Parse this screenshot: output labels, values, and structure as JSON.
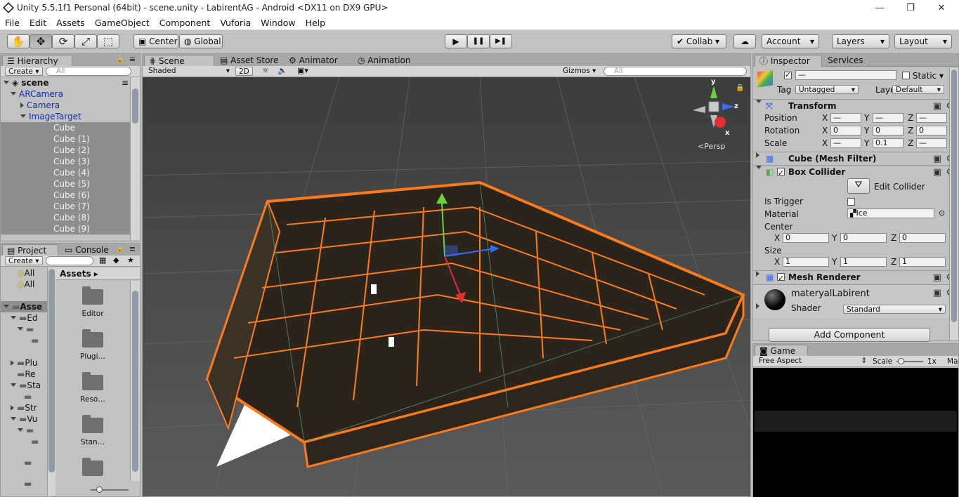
{
  "window": {
    "title": "Unity 5.5.1f1 Personal (64bit) - scene.unity - LabirentAG - Android <DX11 on DX9 GPU>",
    "min_glyph": "—",
    "max_glyph": "❐",
    "close_glyph": "✕"
  },
  "menu": [
    "File",
    "Edit",
    "Assets",
    "GameObject",
    "Component",
    "Vuforia",
    "Window",
    "Help"
  ],
  "toolbar": {
    "tools": [
      "hand-icon",
      "move-icon",
      "rotate-icon",
      "scale-icon",
      "rect-icon"
    ],
    "tool_glyphs": [
      "✋",
      "✥",
      "⟳",
      "⤢",
      "⬚"
    ],
    "center_label": "Center",
    "global_label": "Global",
    "play_glyph": "▶",
    "pause_glyph": "❚❚",
    "step_glyph": "▶❚",
    "collab_label": "Collab ▾",
    "cloud_glyph": "☁",
    "account_label": "Account",
    "layers_label": "Layers",
    "layout_label": "Layout"
  },
  "hierarchy": {
    "tab": "Hierarchy",
    "create": "Create",
    "search_placeholder": "All",
    "scene": "scene",
    "items": [
      {
        "label": "ARCamera",
        "indent": 1,
        "arrow": "down",
        "color": "blue"
      },
      {
        "label": "Camera",
        "indent": 2,
        "arrow": "right",
        "color": "blue"
      },
      {
        "label": "ImageTarget",
        "indent": 2,
        "arrow": "down",
        "color": "blue"
      },
      {
        "label": "Cube",
        "indent": 3,
        "arrow": "",
        "color": "grey"
      },
      {
        "label": "Cube (1)",
        "indent": 3,
        "arrow": "",
        "color": "grey"
      },
      {
        "label": "Cube (2)",
        "indent": 3,
        "arrow": "",
        "color": "grey"
      },
      {
        "label": "Cube (3)",
        "indent": 3,
        "arrow": "",
        "color": "grey"
      },
      {
        "label": "Cube (4)",
        "indent": 3,
        "arrow": "",
        "color": "grey"
      },
      {
        "label": "Cube (5)",
        "indent": 3,
        "arrow": "",
        "color": "grey"
      },
      {
        "label": "Cube (6)",
        "indent": 3,
        "arrow": "",
        "color": "grey"
      },
      {
        "label": "Cube (7)",
        "indent": 3,
        "arrow": "",
        "color": "grey"
      },
      {
        "label": "Cube (8)",
        "indent": 3,
        "arrow": "",
        "color": "grey"
      },
      {
        "label": "Cube (9)",
        "indent": 3,
        "arrow": "",
        "color": "grey"
      }
    ]
  },
  "project": {
    "tab_project": "Project",
    "tab_console": "Console",
    "create": "Create",
    "tree": [
      "All",
      "All",
      "Asse",
      "Ed",
      "",
      "",
      "Plu",
      "Re",
      "Sta",
      "",
      "Str",
      "Vu",
      "",
      "",
      "",
      ""
    ],
    "assets_header": "Assets ▸",
    "folders": [
      "Editor",
      "Plugi…",
      "Reso…",
      "Stan…",
      ""
    ]
  },
  "scene": {
    "tabs": [
      "Scene",
      "Asset Store",
      "Animator",
      "Animation"
    ],
    "shading": "Shaded",
    "mode_2d": "2D",
    "gizmos": "Gizmos",
    "search_placeholder": "All",
    "persp_label": "Persp",
    "axis_y": "y",
    "axis_z": "z",
    "axis_x": "x"
  },
  "inspector": {
    "tab": "Inspector",
    "tab_services": "Services",
    "name_value": "—",
    "static_label": "Static",
    "tag_label": "Tag",
    "tag_value": "Untagged",
    "layer_label": "Layer",
    "layer_value": "Default",
    "transform": {
      "title": "Transform",
      "rows": [
        {
          "label": "Position",
          "x": "—",
          "y": "—",
          "z": "—"
        },
        {
          "label": "Rotation",
          "x": "0",
          "y": "0",
          "z": "0"
        },
        {
          "label": "Scale",
          "x": "—",
          "y": "0.1",
          "z": "—"
        }
      ]
    },
    "mesh_filter": "Cube (Mesh Filter)",
    "box_collider": {
      "title": "Box Collider",
      "edit_label": "Edit Collider",
      "trigger_label": "Is Trigger",
      "material_label": "Material",
      "material_value": "Ice",
      "center_label": "Center",
      "center": {
        "x": "0",
        "y": "0",
        "z": "0"
      },
      "size_label": "Size",
      "size": {
        "x": "1",
        "y": "1",
        "z": "1"
      }
    },
    "mesh_renderer": "Mesh Renderer",
    "material": {
      "name": "materyalLabirent",
      "shader_label": "Shader",
      "shader_value": "Standard"
    },
    "add_component": "Add Component"
  },
  "game": {
    "tab": "Game",
    "aspect": "Free Aspect",
    "scale_label": "Scale",
    "scale_value": "1x",
    "extra": "Ma"
  },
  "axis_labels": {
    "x": "X",
    "y": "Y",
    "z": "Z"
  },
  "colors": {
    "maze_outline": "#ff7a1a",
    "scene_bg": "#4a4a4a",
    "selection_blue": "#0e2fa8"
  }
}
